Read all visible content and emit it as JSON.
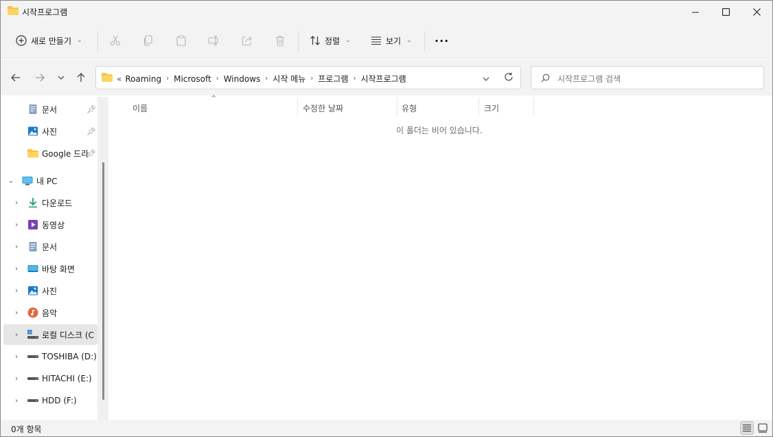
{
  "window": {
    "title": "시작프로그램"
  },
  "toolbar": {
    "new_label": "새로 만들기",
    "sort_label": "정렬",
    "view_label": "보기",
    "more_label": "···"
  },
  "address": {
    "overflow": "«",
    "crumbs": [
      "Roaming",
      "Microsoft",
      "Windows",
      "시작 메뉴",
      "프로그램",
      "시작프로그램"
    ]
  },
  "search": {
    "placeholder": "시작프로그램 검색"
  },
  "nav": {
    "quick": [
      {
        "label": "문서",
        "icon": "document-icon"
      },
      {
        "label": "사진",
        "icon": "pictures-icon"
      },
      {
        "label": "Google 드라",
        "icon": "folder-icon"
      }
    ],
    "pc_label": "내 PC",
    "pc_items": [
      {
        "label": "다운로드",
        "icon": "download-icon"
      },
      {
        "label": "동영상",
        "icon": "video-icon"
      },
      {
        "label": "문서",
        "icon": "document-icon"
      },
      {
        "label": "바탕 화면",
        "icon": "desktop-icon"
      },
      {
        "label": "사진",
        "icon": "pictures-icon"
      },
      {
        "label": "음악",
        "icon": "music-icon"
      },
      {
        "label": "로컬 디스크 (C",
        "icon": "local-disk-icon"
      },
      {
        "label": "TOSHIBA (D:)",
        "icon": "drive-icon"
      },
      {
        "label": "HITACHI (E:)",
        "icon": "drive-icon"
      },
      {
        "label": "HDD (F:)",
        "icon": "drive-icon"
      }
    ]
  },
  "columns": {
    "name": "이름",
    "modified": "수정한 날짜",
    "type": "유형",
    "size": "크기"
  },
  "content": {
    "empty_message": "이 폴더는 비어 있습니다."
  },
  "status": {
    "item_count": "0개 항목"
  },
  "colors": {
    "folder": "#f7c34a",
    "accent": "#0067c0",
    "chrome": "#f3f3f3"
  }
}
